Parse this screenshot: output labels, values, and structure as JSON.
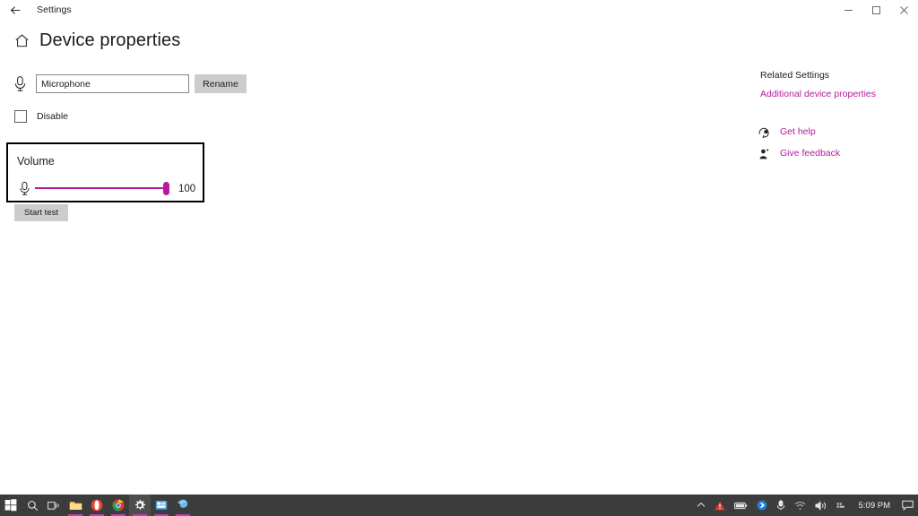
{
  "window": {
    "app_title": "Settings",
    "back_label": "←",
    "controls": {
      "minimize": "minimize-button",
      "maximize": "maximize-button",
      "close": "close-button"
    }
  },
  "page": {
    "title": "Device properties",
    "home_icon": "home-icon"
  },
  "device": {
    "mic_icon": "microphone-icon",
    "name_value": "Microphone",
    "name_placeholder": "Microphone",
    "rename_label": "Rename",
    "disable_label": "Disable",
    "disable_checked": false
  },
  "volume": {
    "section_title": "Volume",
    "mic_icon": "microphone-icon",
    "value": "100",
    "percent": 100,
    "start_test_label": "Start test"
  },
  "related": {
    "heading": "Related Settings",
    "links": [
      {
        "label": "Additional device properties"
      }
    ],
    "help_items": [
      {
        "label": "Get help",
        "icon": "help-headset-icon"
      },
      {
        "label": "Give feedback",
        "icon": "feedback-person-icon"
      }
    ]
  },
  "colors": {
    "accent": "#b5199e",
    "taskbar": "#3c3c3c",
    "button": "#cccccc",
    "focus_rect": "#000000"
  },
  "taskbar": {
    "items": [
      {
        "name": "start-button",
        "icon": "windows-logo-icon",
        "active": false,
        "running": false
      },
      {
        "name": "search-button",
        "icon": "search-icon",
        "active": false,
        "running": false
      },
      {
        "name": "task-view-button",
        "icon": "task-view-icon",
        "active": false,
        "running": false
      },
      {
        "name": "file-explorer-button",
        "icon": "folder-icon",
        "active": false,
        "running": true
      },
      {
        "name": "opera-button",
        "icon": "opera-icon",
        "active": false,
        "running": true
      },
      {
        "name": "chrome-button",
        "icon": "chrome-icon",
        "active": false,
        "running": true
      },
      {
        "name": "settings-button",
        "icon": "gear-icon",
        "active": true,
        "running": true
      },
      {
        "name": "store-button",
        "icon": "store-icon",
        "active": false,
        "running": true
      },
      {
        "name": "paint-button",
        "icon": "paint-icon",
        "active": false,
        "running": true
      }
    ],
    "tray": [
      {
        "name": "show-hidden-icons",
        "icon": "chevron-up-icon"
      },
      {
        "name": "warning-status-icon",
        "icon": "warning-triangle-icon"
      },
      {
        "name": "battery-icon",
        "icon": "battery-icon"
      },
      {
        "name": "bluetooth-icon",
        "icon": "bluetooth-icon"
      },
      {
        "name": "microphone-in-use-icon",
        "icon": "microphone-icon"
      },
      {
        "name": "network-icon",
        "icon": "wifi-icon"
      },
      {
        "name": "volume-icon",
        "icon": "speaker-icon"
      },
      {
        "name": "input-indicator",
        "icon": "language-icon"
      }
    ],
    "clock": "5:09 PM",
    "action_center": "notification-icon"
  }
}
